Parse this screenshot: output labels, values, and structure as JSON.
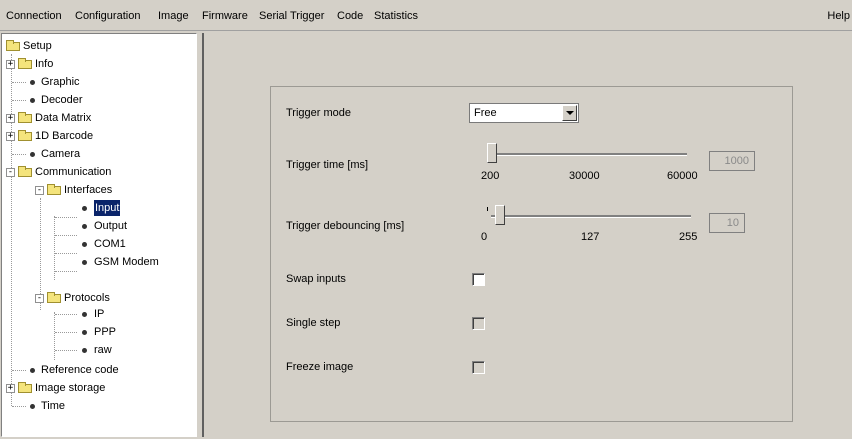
{
  "menu": {
    "items": [
      "Connection",
      "Configuration",
      "Image",
      "Firmware",
      "Serial Trigger",
      "Code",
      "Statistics"
    ],
    "help": "Help"
  },
  "tree": {
    "root": "Setup",
    "info": "Info",
    "graphic": "Graphic",
    "decoder": "Decoder",
    "data_matrix": "Data Matrix",
    "barcode_1d": "1D Barcode",
    "camera": "Camera",
    "communication": "Communication",
    "interfaces": "Interfaces",
    "input": "Input",
    "output": "Output",
    "com1": "COM1",
    "gsm_modem": "GSM Modem",
    "protocols": "Protocols",
    "ip": "IP",
    "ppp": "PPP",
    "raw": "raw",
    "reference_code": "Reference code",
    "image_storage": "Image storage",
    "time": "Time",
    "selected": "Input"
  },
  "form": {
    "trigger_mode": {
      "label": "Trigger mode",
      "value": "Free"
    },
    "trigger_time": {
      "label": "Trigger time [ms]",
      "min_label": "200",
      "mid_label": "30000",
      "max_label": "60000",
      "value": "1000",
      "slider_position": 0.0
    },
    "trigger_debouncing": {
      "label": "Trigger debouncing [ms]",
      "min_label": "0",
      "mid_label": "127",
      "max_label": "255",
      "value": "10",
      "slider_position": 0.04
    },
    "swap_inputs": {
      "label": "Swap inputs",
      "checked": false,
      "enabled": true
    },
    "single_step": {
      "label": "Single step",
      "checked": false,
      "enabled": false
    },
    "freeze_image": {
      "label": "Freeze image",
      "checked": false,
      "enabled": false
    }
  },
  "colors": {
    "window_bg": "#d4d0c8",
    "selection_bg": "#0a246a",
    "folder": "#f4e47c"
  }
}
